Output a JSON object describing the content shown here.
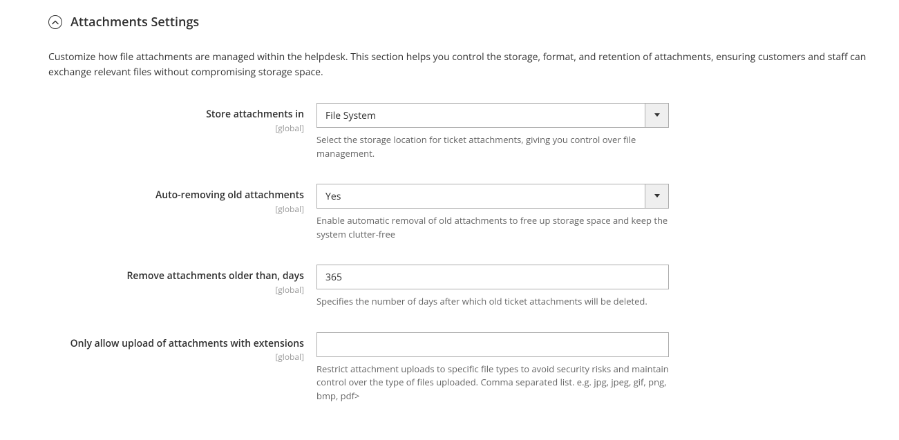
{
  "section": {
    "title": "Attachments Settings",
    "description": "Customize how file attachments are managed within the helpdesk. This section helps you control the storage, format, and retention of attachments, ensuring customers and staff can exchange relevant files without compromising storage space."
  },
  "fields": {
    "storage": {
      "label": "Store attachments in",
      "scope": "[global]",
      "value": "File System",
      "note": "Select the storage location for ticket attachments, giving you control over file management."
    },
    "auto_remove": {
      "label": "Auto-removing old attachments",
      "scope": "[global]",
      "value": "Yes",
      "note": "Enable automatic removal of old attachments to free up storage space and keep the system clutter-free"
    },
    "older_than": {
      "label": "Remove attachments older than, days",
      "scope": "[global]",
      "value": "365",
      "note": "Specifies the number of days after which old ticket attachments will be deleted."
    },
    "extensions": {
      "label": "Only allow upload of attachments with extensions",
      "scope": "[global]",
      "value": "",
      "note": "Restrict attachment uploads to specific file types to avoid security risks and maintain control over the type of files uploaded. Comma separated list. e.g. jpg, jpeg, gif, png, bmp, pdf>"
    }
  }
}
